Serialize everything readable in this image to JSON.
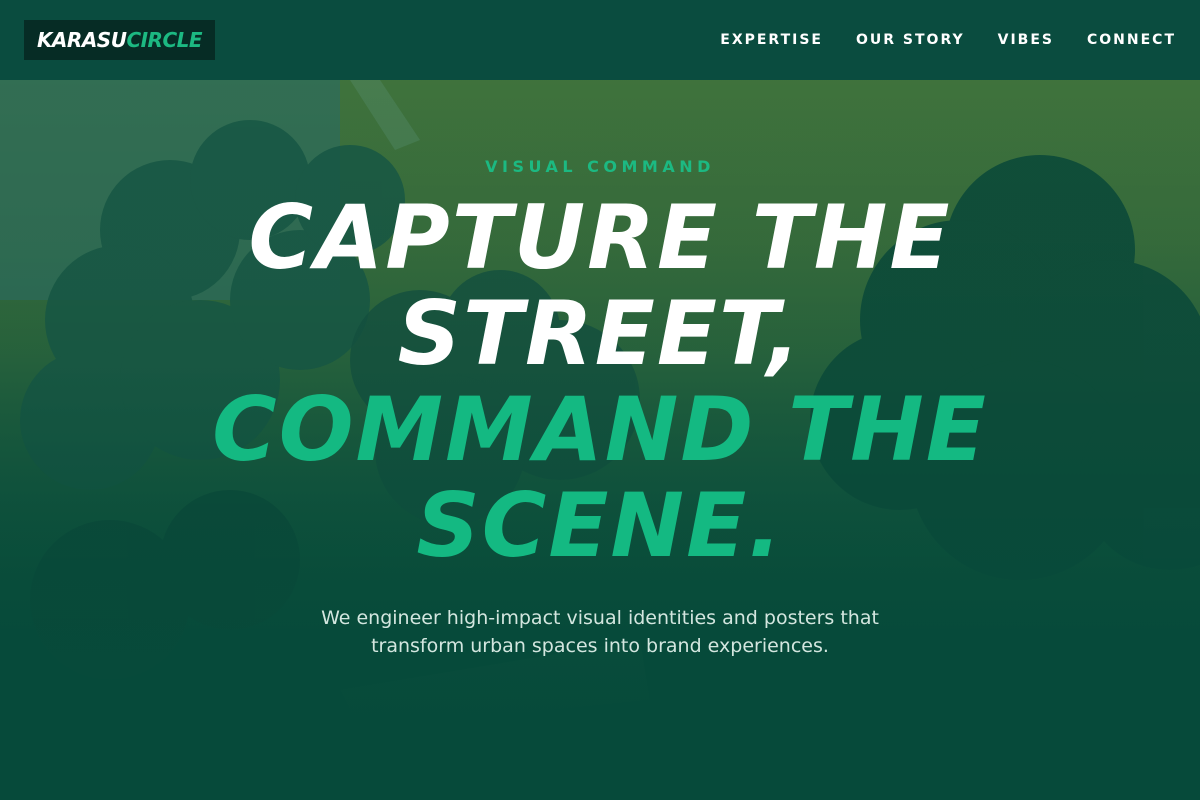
{
  "header": {
    "logo": {
      "part1": "KARASU",
      "part2": "CIRCLE"
    },
    "nav": [
      {
        "label": "EXPERTISE"
      },
      {
        "label": "OUR STORY"
      },
      {
        "label": "VIBES"
      },
      {
        "label": "CONNECT"
      }
    ]
  },
  "hero": {
    "eyebrow": "VISUAL COMMAND",
    "headline": {
      "line1": "CAPTURE THE",
      "line2": "STREET,",
      "line3": "COMMAND THE",
      "line4": "SCENE."
    },
    "subtext": "We engineer high-impact visual identities and posters that transform urban spaces into brand experiences."
  },
  "colors": {
    "primary_dark": "#0a4c3f",
    "accent": "#14b982",
    "logo_bg": "#062c25",
    "text_light": "#d3e6df"
  }
}
